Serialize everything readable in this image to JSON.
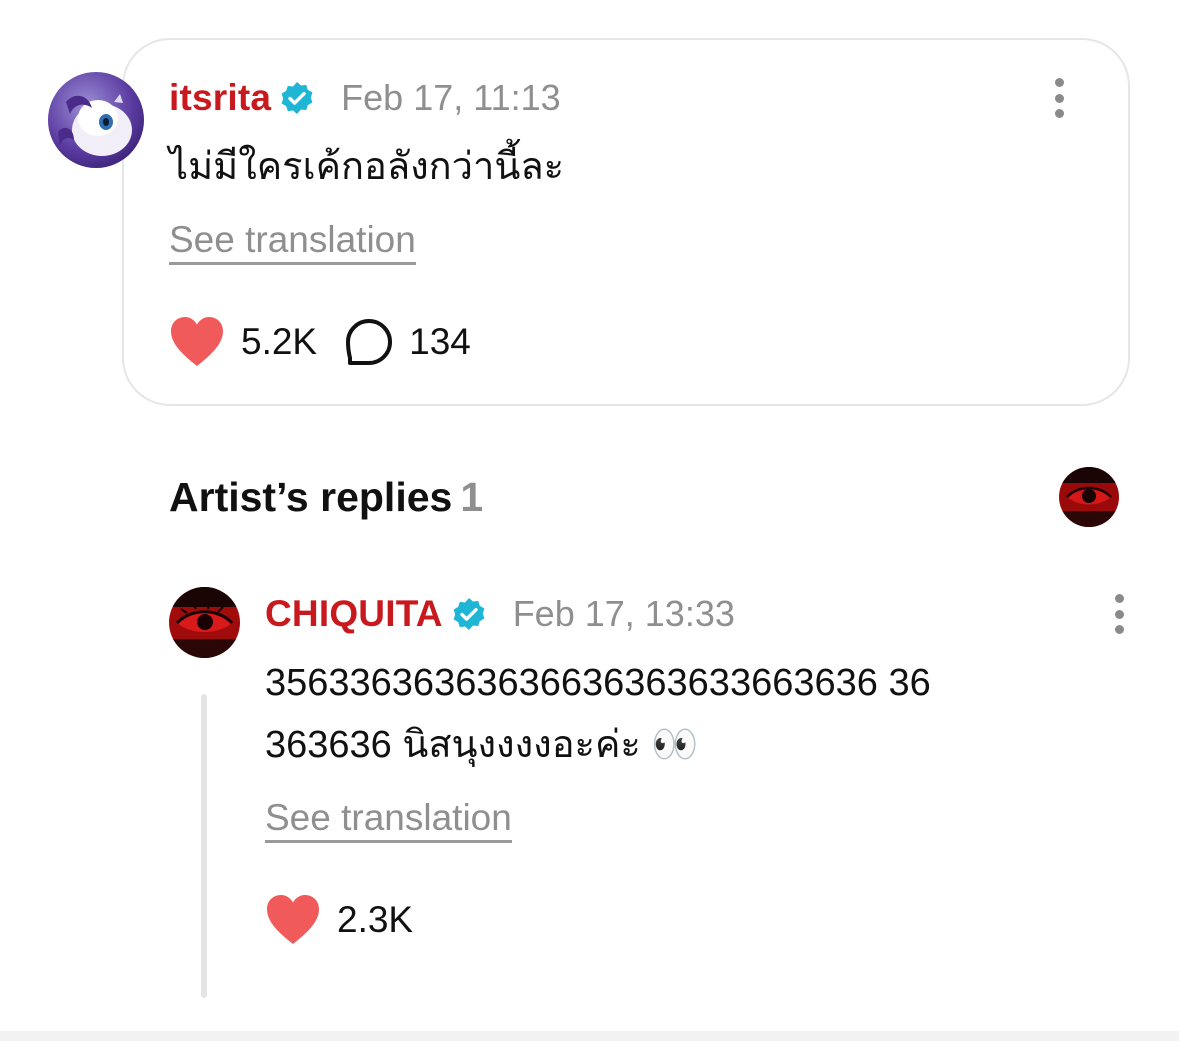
{
  "main_comment": {
    "username": "itsrita",
    "timestamp": "Feb 17, 11:13",
    "text": "ไม่มีใครเค้กอลังกว่านี้ละ",
    "see_translation": "See translation",
    "likes": "5.2K",
    "replies": "134",
    "verified": true
  },
  "artist_replies": {
    "title": "Artist’s replies",
    "count": "1"
  },
  "reply": {
    "username": "CHIQUITA",
    "timestamp": "Feb 17, 13:33",
    "text_line1": "35633636363636636363633663636 36",
    "text_line2": "363636 นิสนุงงงงอะค่ะ 👀",
    "see_translation": "See translation",
    "likes": "2.3K",
    "verified": true
  },
  "icons": {
    "verified": "verified-badge-icon",
    "heart": "heart-icon",
    "reply": "speech-bubble-icon",
    "more": "more-options-icon"
  },
  "colors": {
    "username": "#c8191e",
    "verified": "#1fb6d6",
    "heart": "#f05a5a",
    "muted": "#8f8f8f"
  }
}
